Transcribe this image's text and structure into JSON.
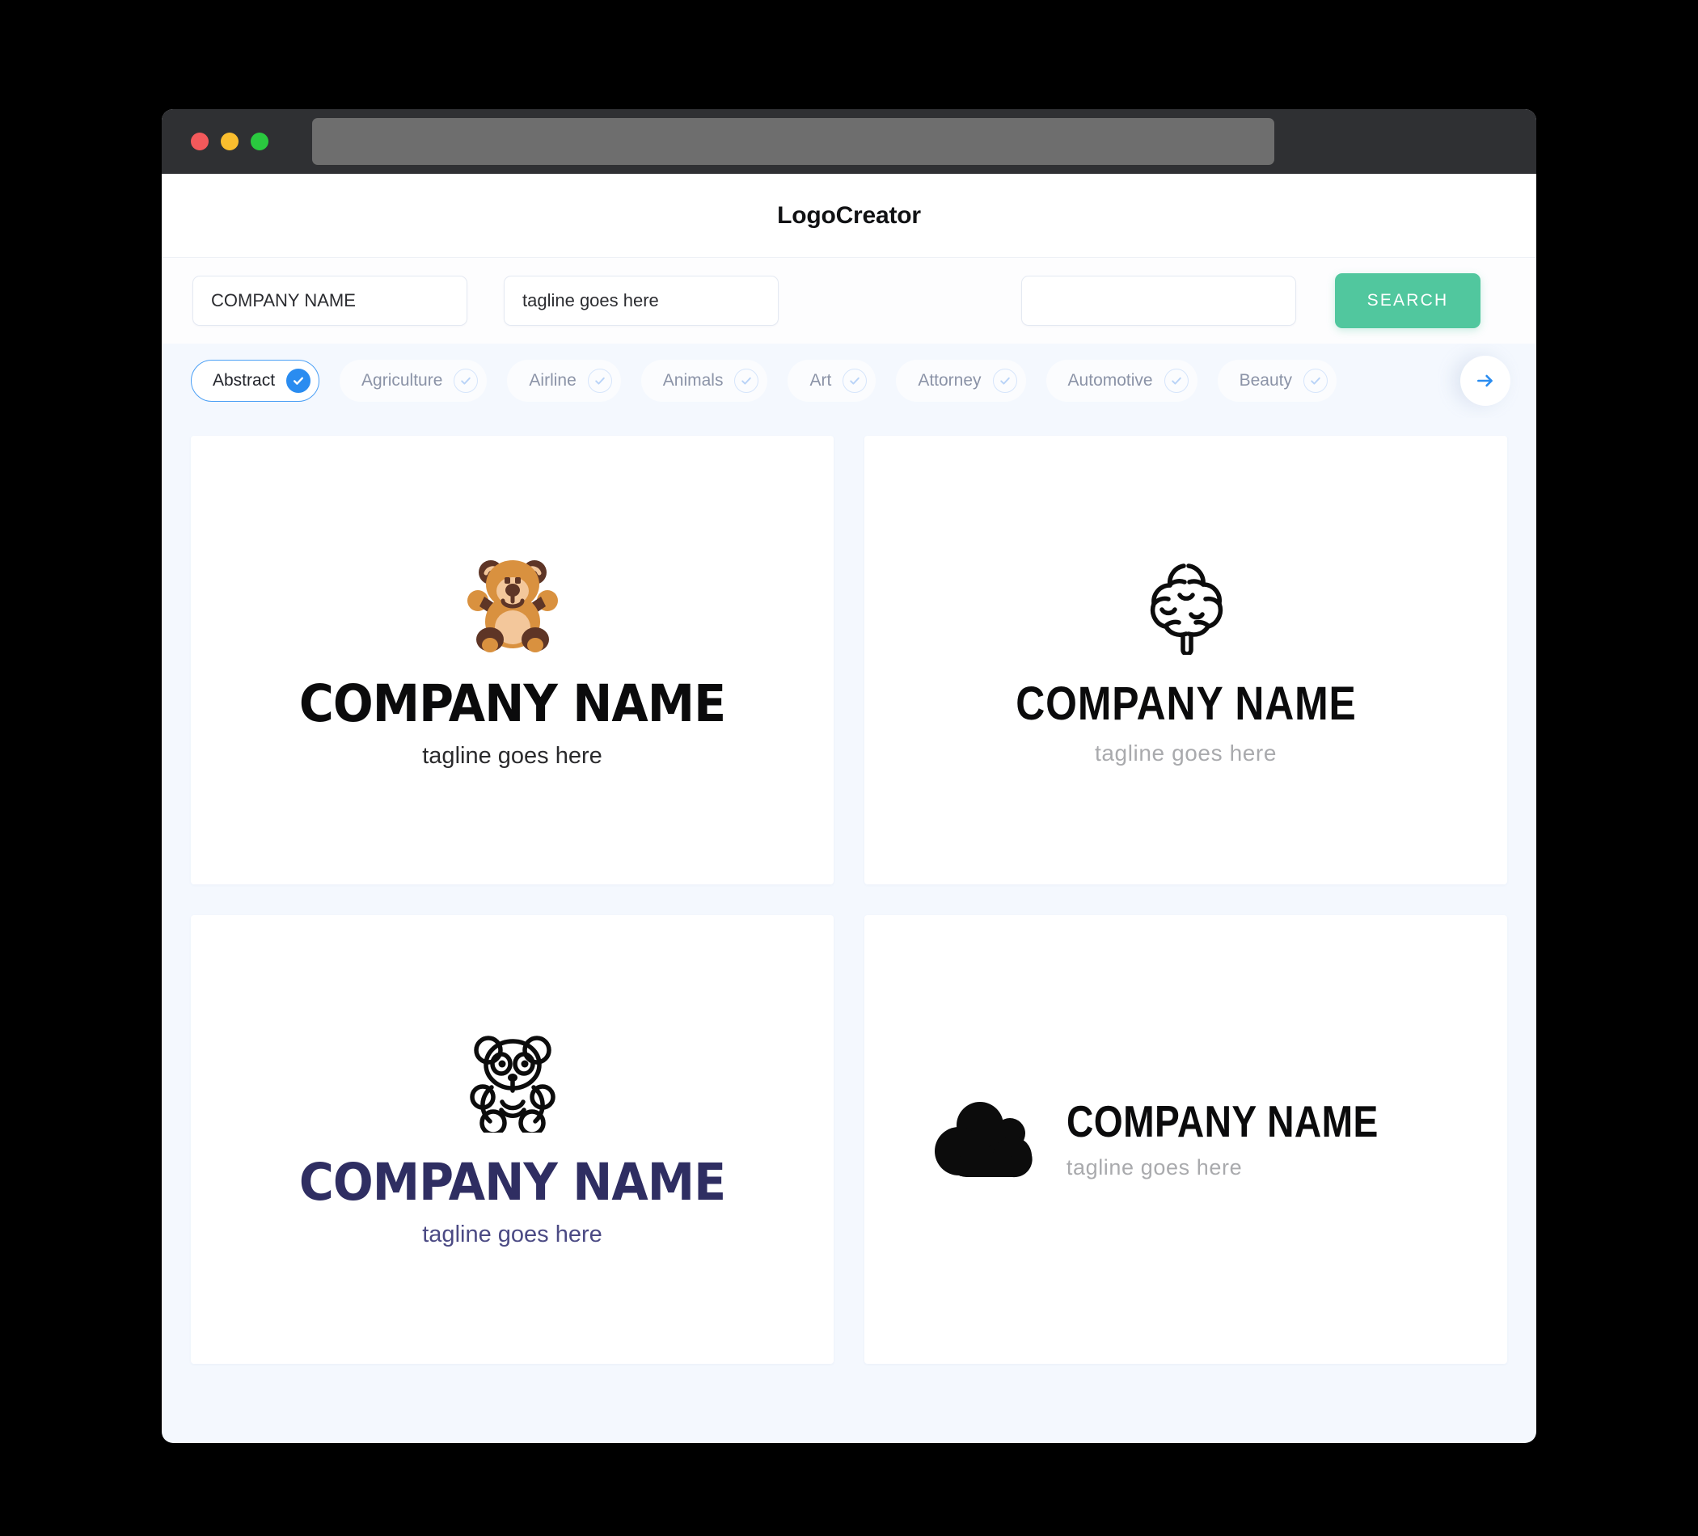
{
  "window": {
    "traffic_lights": [
      "close",
      "minimize",
      "maximize"
    ],
    "url_value": ""
  },
  "header": {
    "title": "LogoCreator"
  },
  "search": {
    "company_value": "COMPANY NAME",
    "company_placeholder": "COMPANY NAME",
    "tagline_value": "tagline goes here",
    "tagline_placeholder": "tagline goes here",
    "extra_value": "",
    "extra_placeholder": "",
    "button_label": "SEARCH",
    "button_color": "#51c79e"
  },
  "categories": {
    "selected": "Abstract",
    "accent_color": "#2a8cf0",
    "next_icon": "arrow-right-icon",
    "items": [
      {
        "label": "Abstract",
        "selected": true
      },
      {
        "label": "Agriculture",
        "selected": false
      },
      {
        "label": "Airline",
        "selected": false
      },
      {
        "label": "Animals",
        "selected": false
      },
      {
        "label": "Art",
        "selected": false
      },
      {
        "label": "Attorney",
        "selected": false
      },
      {
        "label": "Automotive",
        "selected": false
      },
      {
        "label": "Beauty",
        "selected": false
      }
    ]
  },
  "results": {
    "cards": [
      {
        "icon": "teddy-bear-icon",
        "name": "COMPANY NAME",
        "tagline": "tagline goes here",
        "name_color": "#0b0b0c",
        "tagline_color": "#2a2a2c",
        "layout": "stacked"
      },
      {
        "icon": "tree-outline-icon",
        "name": "COMPANY NAME",
        "tagline": "tagline goes here",
        "name_color": "#0b0b0c",
        "tagline_color": "#a9aaad",
        "layout": "stacked"
      },
      {
        "icon": "panda-outline-icon",
        "name": "COMPANY NAME",
        "tagline": "tagline goes here",
        "name_color": "#2f2e62",
        "tagline_color": "#4b4a84",
        "layout": "stacked"
      },
      {
        "icon": "cloud-icon",
        "name": "COMPANY NAME",
        "tagline": "tagline goes here",
        "name_color": "#0b0b0c",
        "tagline_color": "#a9aaad",
        "layout": "horizontal"
      }
    ]
  }
}
